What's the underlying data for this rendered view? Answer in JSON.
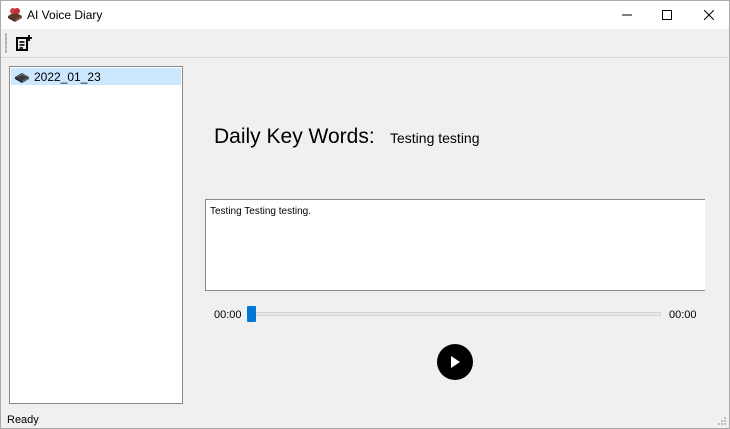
{
  "window": {
    "title": "AI Voice Diary",
    "icon": "diary-book-icon",
    "controls": {
      "minimize": "minimize-icon",
      "maximize": "maximize-icon",
      "close": "close-icon"
    }
  },
  "toolbar": {
    "new_entry_icon": "new-note-icon"
  },
  "sidebar": {
    "entries": [
      {
        "label": "2022_01_23",
        "icon": "book-icon",
        "selected": true
      }
    ]
  },
  "main": {
    "keywords_label": "Daily Key Words:",
    "keywords_value": "Testing testing",
    "transcript": "Testing Testing testing."
  },
  "player": {
    "current_time": "00:00",
    "total_time": "00:00",
    "progress": 0,
    "play_icon": "play-icon"
  },
  "status_bar": {
    "text": "Ready"
  },
  "colors": {
    "accent": "#0078d7",
    "selection": "#cce8ff",
    "surface": "#f0f0f0"
  }
}
